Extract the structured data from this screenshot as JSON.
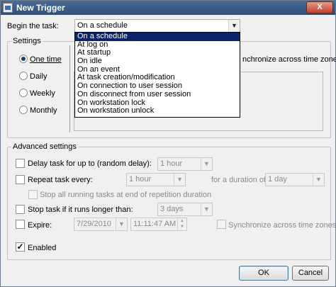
{
  "window": {
    "title": "New Trigger",
    "close_label": "X"
  },
  "begin": {
    "label": "Begin the task:",
    "value": "On a schedule"
  },
  "dropdown": {
    "options": [
      "On a schedule",
      "At log on",
      "At startup",
      "On idle",
      "On an event",
      "At task creation/modification",
      "On connection to user session",
      "On disconnect from user session",
      "On workstation lock",
      "On workstation unlock"
    ],
    "selected_index": 0
  },
  "settings": {
    "title": "Settings",
    "radios": [
      "One time",
      "Daily",
      "Weekly",
      "Monthly"
    ],
    "sync_partial": "nchronize across time zones"
  },
  "advanced": {
    "title": "Advanced settings",
    "delay": {
      "label": "Delay task for up to (random delay):",
      "value": "1 hour"
    },
    "repeat": {
      "label": "Repeat task every:",
      "value": "1 hour",
      "duration_label": "for a duration of:",
      "duration_value": "1 day"
    },
    "stop_running": {
      "label": "Stop all running tasks at end of repetition duration"
    },
    "stop_longer": {
      "label": "Stop task if it runs longer than:",
      "value": "3 days"
    },
    "expire": {
      "label": "Expire:",
      "date": "7/29/2010",
      "time": "11:11:47 AM",
      "sync_label": "Synchronize across time zones"
    },
    "enabled": {
      "label": "Enabled",
      "checked": true
    }
  },
  "buttons": {
    "ok": "OK",
    "cancel": "Cancel"
  },
  "colors": {
    "selection": "#0a246a",
    "title_bar": "#2f4f78"
  }
}
